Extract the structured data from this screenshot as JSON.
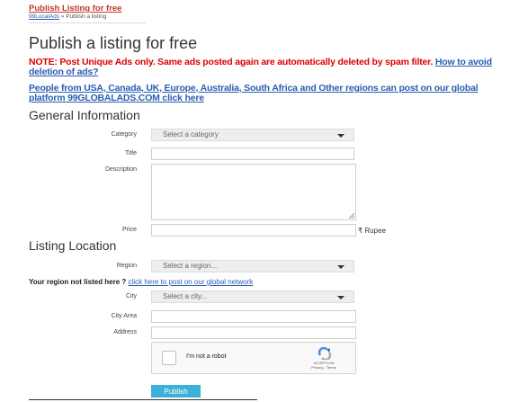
{
  "header": {
    "top_link": "Publish Listing for free",
    "breadcrumb_home": "99LocalAds",
    "breadcrumb_sep": "»",
    "breadcrumb_current": "Publish a listing"
  },
  "page_title": "Publish a listing for free",
  "note": {
    "text": "NOTE: Post Unique Ads only. Same ads posted again are automatically deleted by spam filter.",
    "link": "How to avoid deletion of ads?"
  },
  "global_link": "People from USA, Canada, UK, Europe, Australia, South Africa and Other regions can post on our global platform 99GLOBALADS.COM click here",
  "general": {
    "heading": "General Information",
    "category_label": "Category",
    "category_value": "Select a category",
    "title_label": "Title",
    "description_label": "Description",
    "price_label": "Price",
    "price_unit": "₹ Rupee"
  },
  "location": {
    "heading": "Listing Location",
    "region_label": "Region",
    "region_value": "Select a region...",
    "not_listed_text": "Your region not listed here ?",
    "not_listed_link": "click here to post on our global network",
    "city_label": "City",
    "city_value": "Select a city...",
    "city_area_label": "City Area",
    "address_label": "Address"
  },
  "captcha": {
    "label": "I'm not a robot",
    "brand": "reCAPTCHA",
    "links": "Privacy - Terms"
  },
  "publish_label": "Publish",
  "colors": {
    "accent": "#3bb0d9",
    "warning": "#e00000",
    "link": "#2a5db0"
  }
}
